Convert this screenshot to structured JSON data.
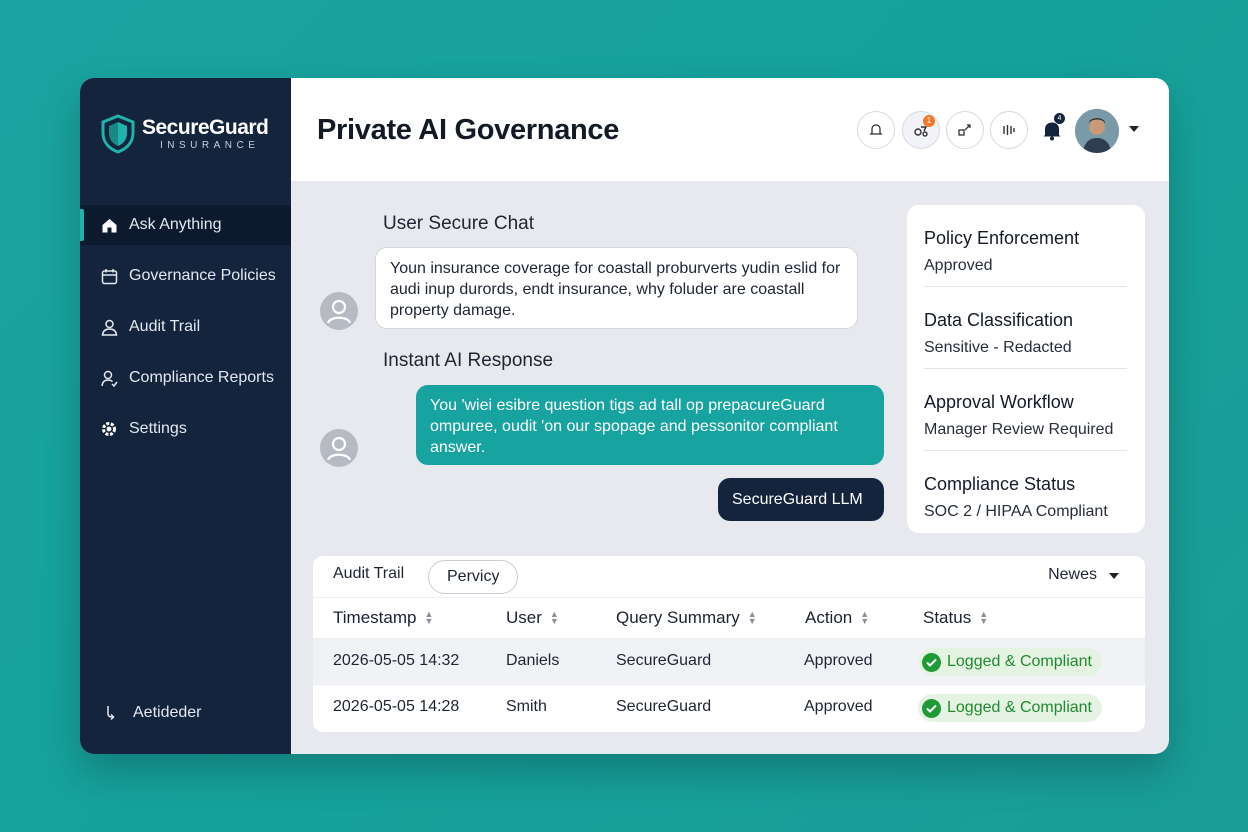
{
  "brand": {
    "name": "SecureGuard",
    "sub": "INSURANCE"
  },
  "sidebar": {
    "items": [
      {
        "label": "Ask Anything",
        "icon": "home-icon",
        "active": true
      },
      {
        "label": "Governance Policies",
        "icon": "calendar-icon"
      },
      {
        "label": "Audit Trail",
        "icon": "user-icon"
      },
      {
        "label": "Compliance Reports",
        "icon": "user-check-icon"
      },
      {
        "label": "Settings",
        "icon": "gear-icon"
      }
    ],
    "bottom_label": "Aetideder"
  },
  "header": {
    "title": "Private AI Governance",
    "icons": [
      "bell-outline-icon",
      "activity-icon",
      "share-icon",
      "bars-icon",
      "bell-icon"
    ],
    "notification_count": "1",
    "bell_count": "4"
  },
  "chat": {
    "user_label": "User Secure Chat",
    "user_message": "Youn insurance coverage for coastall proburverts yudin eslid for audi inup durords, endt insurance, why foluder are coastall property damage.",
    "ai_label": "Instant AI Response",
    "ai_message": "You 'wiei esibre question tigs ad tall op prepacureGuard ompuree, oudit 'on our spopage and pessonitor compliant answer.",
    "llm_label": "SecureGuard LLM"
  },
  "policies": [
    {
      "title": "Policy Enforcement",
      "value": "Approved"
    },
    {
      "title": "Data Classification",
      "value": "Sensitive - Redacted"
    },
    {
      "title": "Approval Workflow",
      "value": "Manager Review Required"
    },
    {
      "title": "Compliance Status",
      "value": "SOC 2 / HIPAA Compliant"
    }
  ],
  "audit": {
    "tabs": [
      "Audit Trail",
      "Pervicy"
    ],
    "news_label": "Newes",
    "columns": [
      "Timestamp",
      "User",
      "Query Summary",
      "Action",
      "Status"
    ],
    "rows": [
      {
        "timestamp": "2026-05-05 14:32",
        "user": "Daniels",
        "query": "SecureGuard",
        "action": "Approved",
        "status": "Logged & Compliant"
      },
      {
        "timestamp": "2026-05-05 14:28",
        "user": "Smith",
        "query": "SecureGuard",
        "action": "Approved",
        "status": "Logged & Compliant"
      }
    ]
  },
  "colors": {
    "accent": "#17a39f",
    "sidebar": "#14243d",
    "status_green": "#1e9b37"
  }
}
